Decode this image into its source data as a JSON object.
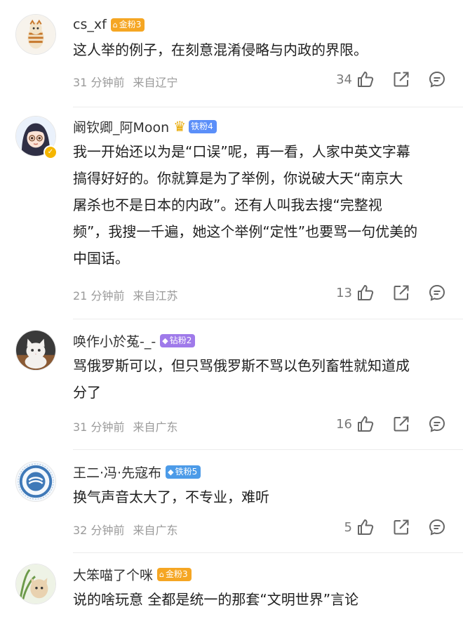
{
  "colors": {
    "gold": "#f5a623",
    "iron": "#5b8ff9",
    "diamond": "#9f7aea",
    "steel": "#4c9be8"
  },
  "comments": [
    {
      "user": "cs_xf",
      "badge": "金粉3",
      "badge_type": "gold",
      "lines": [
        "这人举的例子，在刻意混淆侵略与内政的界限。"
      ],
      "time": "31 分钟前",
      "location": "来自辽宁",
      "likes": "34"
    },
    {
      "user": "阚钦卿_阿Moon",
      "badge": "铁粉4",
      "badge_type": "iron",
      "lines": [
        "我一开始还以为是“口误”呢，再一看，人家中英文字幕",
        "搞得好好的。你就算是为了举例，你说破大天“南京大",
        "屠杀也不是日本的内政”。还有人叫我去搜“完整视",
        "频”，我搜一千遍，她这个举例“定性”也要骂一句优美的",
        "中国话。"
      ],
      "time": "21 分钟前",
      "location": "来自江苏",
      "likes": "13"
    },
    {
      "user": "唤作小於菟-_-",
      "badge": "钻粉2",
      "badge_type": "diamond",
      "lines": [
        "骂俄罗斯可以，但只骂俄罗斯不骂以色列畜牲就知道成",
        "分了"
      ],
      "time": "31 分钟前",
      "location": "来自广东",
      "likes": "16"
    },
    {
      "user": "王二·冯·先寇布",
      "badge": "铁粉5",
      "badge_type": "steel",
      "lines": [
        "换气声音太大了，不专业，难听"
      ],
      "time": "32 分钟前",
      "location": "来自广东",
      "likes": "5"
    },
    {
      "user": "大笨喵了个咪",
      "badge": "金粉3",
      "badge_type": "gold",
      "lines": [
        "说的啥玩意 全都是统一的那套“文明世界”言论"
      ],
      "time": "",
      "location": "",
      "likes": ""
    }
  ]
}
